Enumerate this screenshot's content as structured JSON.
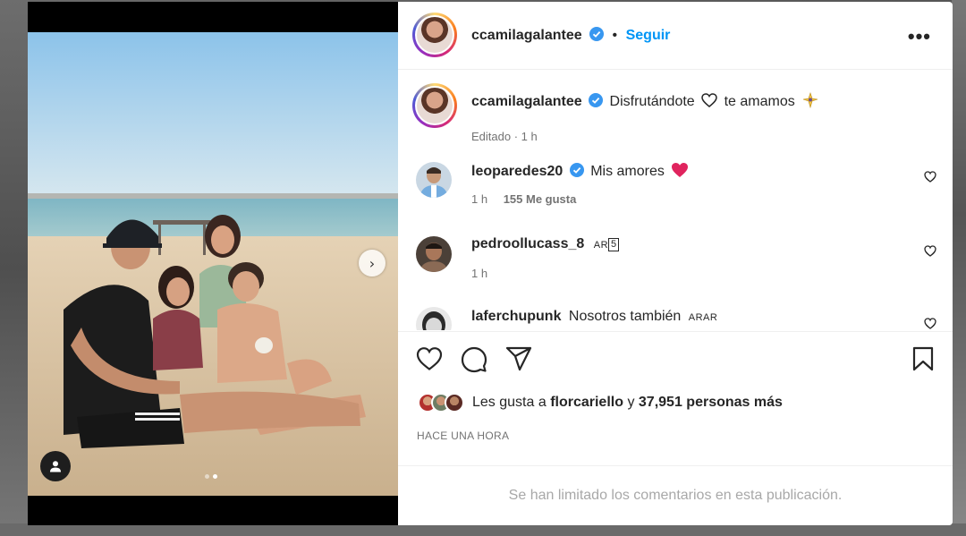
{
  "post": {
    "author": "ccamilagalantee",
    "separator": "•",
    "follow_label": "Seguir",
    "more_label": "•••",
    "caption_text": "Disfrutándote",
    "caption_suffix": "te amamos",
    "caption_meta": "Editado · 1 h"
  },
  "comments": [
    {
      "user": "leoparedes20",
      "verified": true,
      "text": "Mis amores",
      "emoji": "red-heart",
      "time": "1 h",
      "likes": "155 Me gusta"
    },
    {
      "user": "pedroollucass_8",
      "verified": false,
      "flag_text": "AR",
      "flag_box": "5",
      "text": "",
      "time": "1 h",
      "likes": ""
    },
    {
      "user": "laferchupunk",
      "verified": false,
      "text": "Nosotros también",
      "flag_text": "ARAR",
      "time": "",
      "likes": ""
    }
  ],
  "likes": {
    "prefix": "Les gusta a",
    "first_user": "florcariello",
    "joiner": "y",
    "others": "37,951 personas más"
  },
  "time_ago": "HACE UNA HORA",
  "comments_limited": "Se han limitado los comentarios en esta publicación.",
  "colors": {
    "link_blue": "#0095f6",
    "verified_blue": "#3897f0",
    "heart_red": "#ed4956"
  },
  "icons": {
    "like": "heart-outline-icon",
    "comment": "comment-bubble-icon",
    "share": "paper-plane-icon",
    "save": "bookmark-icon",
    "next": "chevron-right-icon",
    "tagged": "user-tag-icon"
  },
  "carousel": {
    "slides": 2,
    "current": 2
  }
}
